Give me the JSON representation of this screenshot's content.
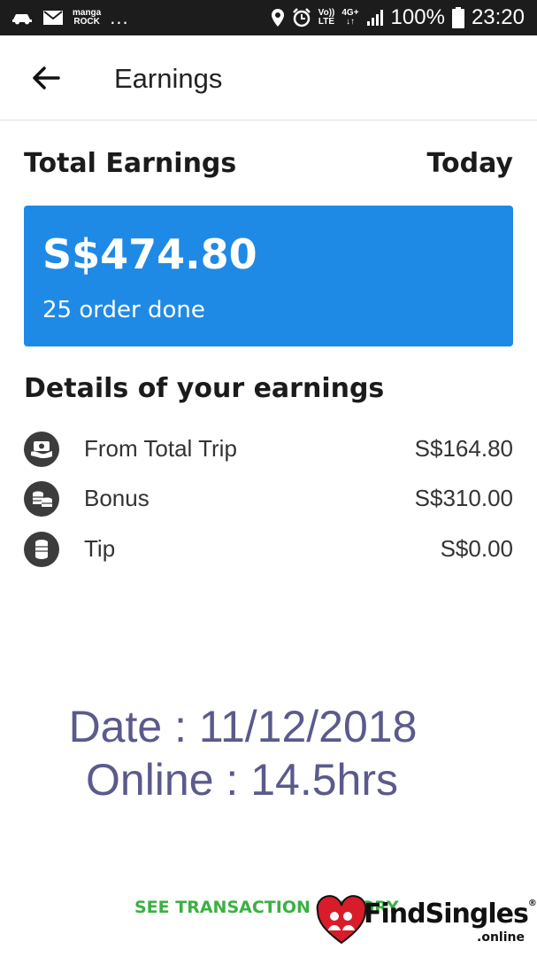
{
  "status_bar": {
    "notif_text_top": "manga",
    "notif_text_bottom": "ROCK",
    "more": "...",
    "volte_top": "Vo))",
    "volte_bottom": "LTE",
    "net_type": "4G+",
    "battery": "100%",
    "time": "23:20"
  },
  "header": {
    "title": "Earnings"
  },
  "total": {
    "label": "Total Earnings",
    "period": "Today",
    "amount": "S$474.80",
    "orders": "25 order done"
  },
  "details": {
    "title": "Details of your earnings",
    "items": [
      {
        "label": "From Total Trip",
        "value": "S$164.80",
        "icon": "money-hand-icon"
      },
      {
        "label": "Bonus",
        "value": "S$310.00",
        "icon": "coins-stack-icon"
      },
      {
        "label": "Tip",
        "value": "S$0.00",
        "icon": "coin-icon"
      }
    ]
  },
  "overlay": {
    "date": "Date : 11/12/2018",
    "online": "Online : 14.5hrs"
  },
  "footer": {
    "link": "SEE TRANSACTION HISTORY"
  },
  "watermark": {
    "brand": "FindSingles",
    "reg": "®",
    "sub": ".online"
  },
  "colors": {
    "primary": "#1f8ae6",
    "link": "#3cb043",
    "overlay_text": "#5a5a8c",
    "status_bar": "#1c1c1c"
  }
}
